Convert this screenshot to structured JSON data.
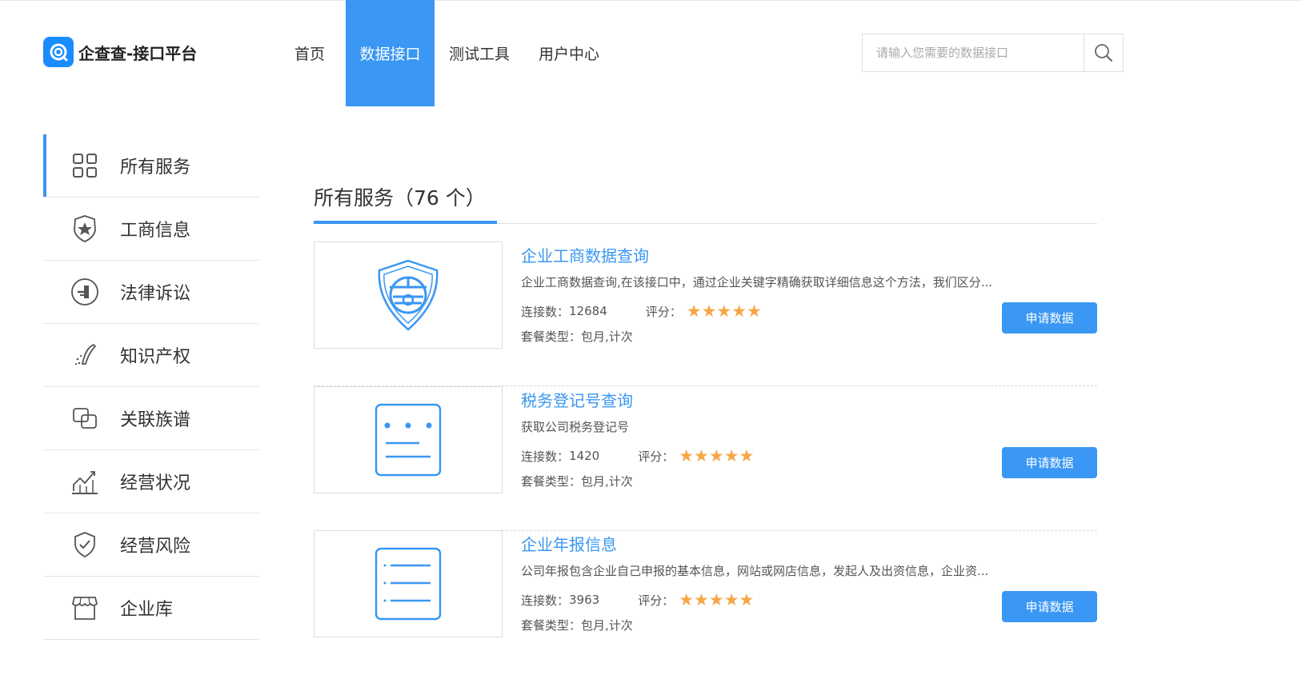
{
  "header": {
    "logo_text": "企查查-接口平台",
    "nav": [
      {
        "label": "首页"
      },
      {
        "label": "数据接口",
        "active": true
      },
      {
        "label": "测试工具"
      },
      {
        "label": "用户中心"
      }
    ],
    "search": {
      "placeholder": "请输入您需要的数据接口",
      "value": ""
    }
  },
  "sidebar": {
    "items": [
      {
        "label": "所有服务",
        "icon": "grid-icon",
        "active": true
      },
      {
        "label": "工商信息",
        "icon": "badge-star-icon"
      },
      {
        "label": "法律诉讼",
        "icon": "gavel-icon"
      },
      {
        "label": "知识产权",
        "icon": "quill-icon"
      },
      {
        "label": "关联族谱",
        "icon": "link-squares-icon"
      },
      {
        "label": "经营状况",
        "icon": "chart-up-icon"
      },
      {
        "label": "经营风险",
        "icon": "shield-check-icon"
      },
      {
        "label": "企业库",
        "icon": "store-icon"
      }
    ]
  },
  "main": {
    "title": "所有服务（76 个）",
    "services": [
      {
        "title": "企业工商数据查询",
        "description": "企业工商数据查询,在该接口中，通过企业关键字精确获取详细信息这个方法，我们区分...",
        "connections_label": "连接数：",
        "connections": "12684",
        "score_label": "评分：",
        "stars": "★★★★★",
        "package_label": "套餐类型：",
        "package": "包月,计次",
        "button_label": "申请数据",
        "icon": "emblem-icon"
      },
      {
        "title": "税务登记号查询",
        "description": "获取公司税务登记号",
        "connections_label": "连接数：",
        "connections": "1420",
        "score_label": "评分：",
        "stars": "★★★★★",
        "package_label": "套餐类型：",
        "package": "包月,计次",
        "button_label": "申请数据",
        "icon": "tax-form-icon"
      },
      {
        "title": "企业年报信息",
        "description": "公司年报包含企业自己申报的基本信息，网站或网店信息，发起人及出资信息，企业资...",
        "connections_label": "连接数：",
        "connections": "3963",
        "score_label": "评分：",
        "stars": "★★★★★",
        "package_label": "套餐类型：",
        "package": "包月,计次",
        "button_label": "申请数据",
        "icon": "list-doc-icon"
      }
    ]
  },
  "colors": {
    "accent": "#3a97f3",
    "star": "#f7a646",
    "text": "#333333"
  }
}
